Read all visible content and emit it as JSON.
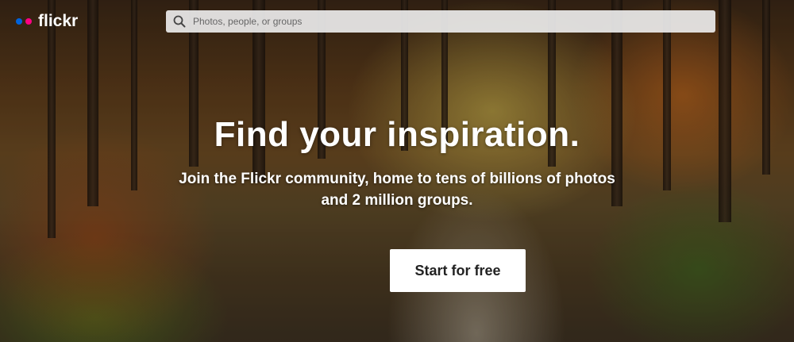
{
  "brand": {
    "name": "flickr",
    "dot_colors": [
      "#0063dc",
      "#ff0084"
    ]
  },
  "search": {
    "placeholder": "Photos, people, or groups",
    "icon": "search-icon"
  },
  "hero": {
    "headline": "Find your inspiration.",
    "subtext": "Join the Flickr community, home to tens of billions of photos and 2 million groups.",
    "cta_label": "Start for free"
  }
}
